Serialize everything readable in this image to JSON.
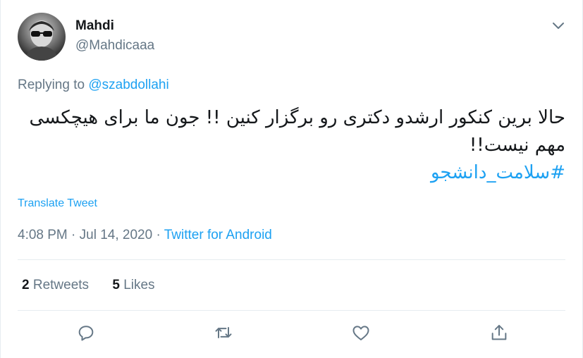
{
  "user": {
    "name": "Mahdi",
    "handle": "@Mahdicaaa"
  },
  "reply": {
    "prefix": "Replying to",
    "to": "@szabdollahi"
  },
  "tweet": {
    "text": "حالا برین کنکور ارشدو دکتری رو برگزار کنین !!  جون ما برای هیچکسی مهم نیست!!",
    "hashtag": "#سلامت_دانشجو"
  },
  "translate_label": "Translate Tweet",
  "meta": {
    "time": "4:08 PM",
    "sep1": " · ",
    "date": "Jul 14, 2020",
    "sep2": " · ",
    "source": "Twitter for Android"
  },
  "stats": {
    "retweets_count": "2",
    "retweets_label": "Retweets",
    "likes_count": "5",
    "likes_label": "Likes"
  },
  "icons": {
    "caret": "chevron-down-icon",
    "reply": "reply-icon",
    "retweet": "retweet-icon",
    "like": "heart-icon",
    "share": "share-icon"
  },
  "colors": {
    "accent": "#1da1f2",
    "secondary_text": "#657786",
    "primary_text": "#14171a",
    "divider": "#e6ecf0"
  }
}
